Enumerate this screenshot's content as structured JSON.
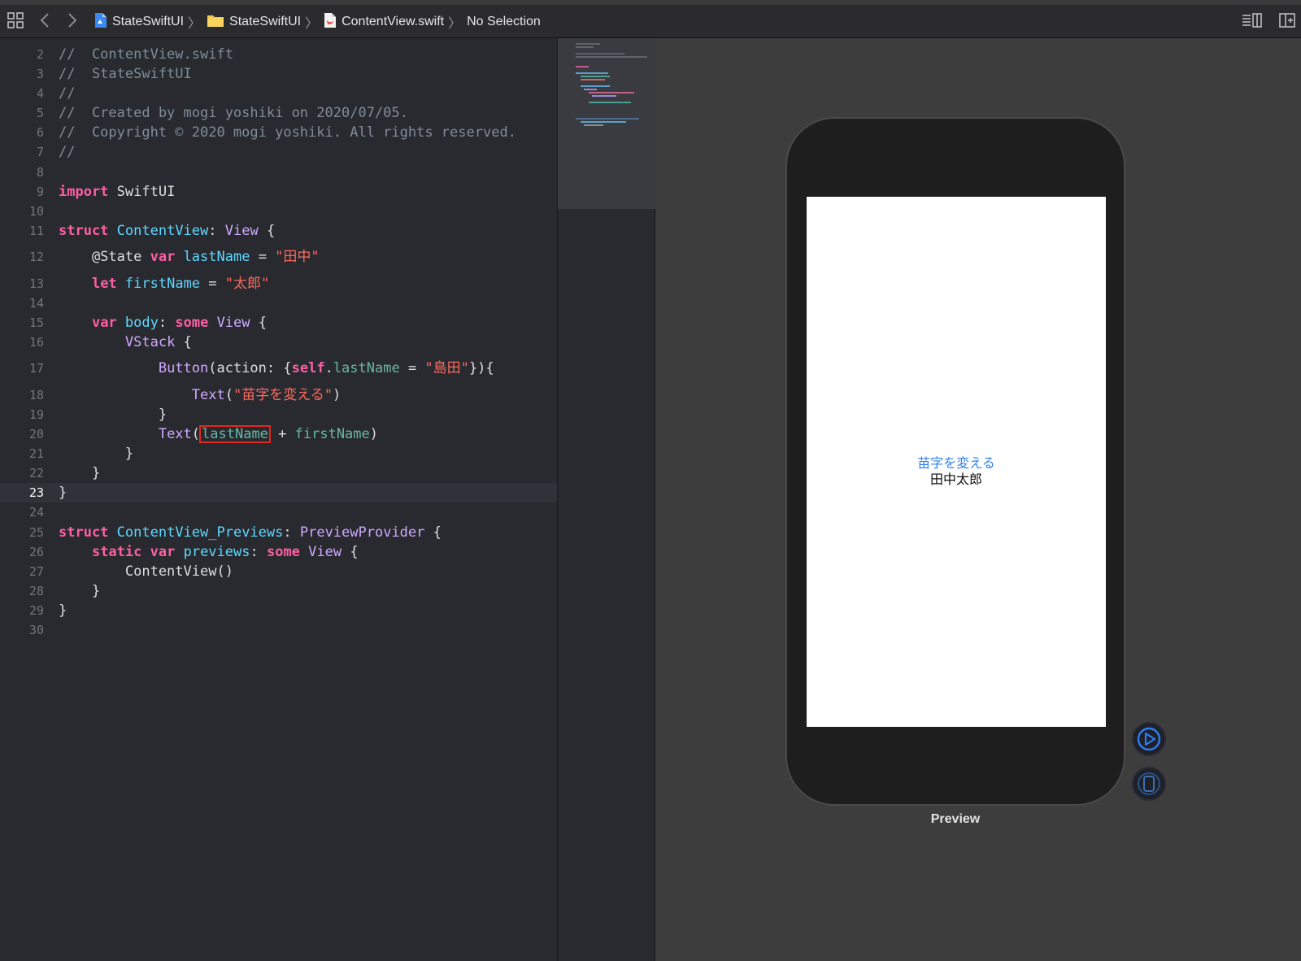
{
  "breadcrumb": {
    "project": "StateSwiftUI",
    "folder": "StateSwiftUI",
    "file": "ContentView.swift",
    "selection": "No Selection"
  },
  "editor": {
    "lines": [
      {
        "n": "2",
        "current": false,
        "tokens": [
          {
            "t": "//  ContentView.swift",
            "c": "com"
          }
        ]
      },
      {
        "n": "3",
        "current": false,
        "tokens": [
          {
            "t": "//  StateSwiftUI",
            "c": "com"
          }
        ]
      },
      {
        "n": "4",
        "current": false,
        "tokens": [
          {
            "t": "//",
            "c": "com"
          }
        ]
      },
      {
        "n": "5",
        "current": false,
        "tokens": [
          {
            "t": "//  Created by mogi yoshiki on 2020/07/05.",
            "c": "com"
          }
        ]
      },
      {
        "n": "6",
        "current": false,
        "tokens": [
          {
            "t": "//  Copyright © 2020 mogi yoshiki. All rights reserved.",
            "c": "com"
          }
        ]
      },
      {
        "n": "7",
        "current": false,
        "tokens": [
          {
            "t": "//",
            "c": "com"
          }
        ]
      },
      {
        "n": "8",
        "current": false,
        "tokens": []
      },
      {
        "n": "9",
        "current": false,
        "tokens": [
          {
            "t": "import",
            "c": "kw"
          },
          {
            "t": " SwiftUI",
            "c": "plain"
          }
        ]
      },
      {
        "n": "10",
        "current": false,
        "tokens": []
      },
      {
        "n": "11",
        "current": false,
        "tokens": [
          {
            "t": "struct",
            "c": "kw"
          },
          {
            "t": " ",
            "c": "plain"
          },
          {
            "t": "ContentView",
            "c": "decl"
          },
          {
            "t": ": ",
            "c": "plain"
          },
          {
            "t": "View",
            "c": "type"
          },
          {
            "t": " {",
            "c": "plain"
          }
        ]
      },
      {
        "n": "12",
        "current": false,
        "tokens": [
          {
            "t": "    @State ",
            "c": "plain"
          },
          {
            "t": "var",
            "c": "kw"
          },
          {
            "t": " ",
            "c": "plain"
          },
          {
            "t": "lastName",
            "c": "decl"
          },
          {
            "t": " = ",
            "c": "plain"
          },
          {
            "t": "\"田中\"",
            "c": "str"
          }
        ]
      },
      {
        "n": "13",
        "current": false,
        "tokens": [
          {
            "t": "    ",
            "c": "plain"
          },
          {
            "t": "let",
            "c": "kw"
          },
          {
            "t": " ",
            "c": "plain"
          },
          {
            "t": "firstName",
            "c": "decl"
          },
          {
            "t": " = ",
            "c": "plain"
          },
          {
            "t": "\"太郎\"",
            "c": "str"
          }
        ]
      },
      {
        "n": "14",
        "current": false,
        "tokens": []
      },
      {
        "n": "15",
        "current": false,
        "tokens": [
          {
            "t": "    ",
            "c": "plain"
          },
          {
            "t": "var",
            "c": "kw"
          },
          {
            "t": " ",
            "c": "plain"
          },
          {
            "t": "body",
            "c": "decl"
          },
          {
            "t": ": ",
            "c": "plain"
          },
          {
            "t": "some",
            "c": "kw"
          },
          {
            "t": " ",
            "c": "plain"
          },
          {
            "t": "View",
            "c": "type"
          },
          {
            "t": " {",
            "c": "plain"
          }
        ]
      },
      {
        "n": "16",
        "current": false,
        "tokens": [
          {
            "t": "        ",
            "c": "plain"
          },
          {
            "t": "VStack",
            "c": "type"
          },
          {
            "t": " {",
            "c": "plain"
          }
        ]
      },
      {
        "n": "17",
        "current": false,
        "tokens": [
          {
            "t": "            ",
            "c": "plain"
          },
          {
            "t": "Button",
            "c": "type"
          },
          {
            "t": "(action: {",
            "c": "plain"
          },
          {
            "t": "self",
            "c": "kw"
          },
          {
            "t": ".",
            "c": "plain"
          },
          {
            "t": "lastName",
            "c": "prop"
          },
          {
            "t": " = ",
            "c": "plain"
          },
          {
            "t": "\"島田\"",
            "c": "str"
          },
          {
            "t": "}){",
            "c": "plain"
          }
        ]
      },
      {
        "n": "18",
        "current": false,
        "tokens": [
          {
            "t": "                ",
            "c": "plain"
          },
          {
            "t": "Text",
            "c": "type"
          },
          {
            "t": "(",
            "c": "plain"
          },
          {
            "t": "\"苗字を変える\"",
            "c": "str"
          },
          {
            "t": ")",
            "c": "plain"
          }
        ]
      },
      {
        "n": "19",
        "current": false,
        "tokens": [
          {
            "t": "            }",
            "c": "plain"
          }
        ]
      },
      {
        "n": "20",
        "current": false,
        "tokens": [
          {
            "t": "            ",
            "c": "plain"
          },
          {
            "t": "Text",
            "c": "type"
          },
          {
            "t": "(",
            "c": "plain"
          },
          {
            "t": "lastName",
            "c": "prop",
            "hl": true
          },
          {
            "t": " + ",
            "c": "plain"
          },
          {
            "t": "firstName",
            "c": "prop"
          },
          {
            "t": ")",
            "c": "plain"
          }
        ]
      },
      {
        "n": "21",
        "current": false,
        "tokens": [
          {
            "t": "        }",
            "c": "plain"
          }
        ]
      },
      {
        "n": "22",
        "current": false,
        "tokens": [
          {
            "t": "    }",
            "c": "plain"
          }
        ]
      },
      {
        "n": "23",
        "current": true,
        "tokens": [
          {
            "t": "}",
            "c": "plain"
          }
        ]
      },
      {
        "n": "24",
        "current": false,
        "tokens": []
      },
      {
        "n": "25",
        "current": false,
        "tokens": [
          {
            "t": "struct",
            "c": "kw"
          },
          {
            "t": " ",
            "c": "plain"
          },
          {
            "t": "ContentView_Previews",
            "c": "decl"
          },
          {
            "t": ": ",
            "c": "plain"
          },
          {
            "t": "PreviewProvider",
            "c": "type"
          },
          {
            "t": " {",
            "c": "plain"
          }
        ]
      },
      {
        "n": "26",
        "current": false,
        "tokens": [
          {
            "t": "    ",
            "c": "plain"
          },
          {
            "t": "static",
            "c": "kw"
          },
          {
            "t": " ",
            "c": "plain"
          },
          {
            "t": "var",
            "c": "kw"
          },
          {
            "t": " ",
            "c": "plain"
          },
          {
            "t": "previews",
            "c": "decl"
          },
          {
            "t": ": ",
            "c": "plain"
          },
          {
            "t": "some",
            "c": "kw"
          },
          {
            "t": " ",
            "c": "plain"
          },
          {
            "t": "View",
            "c": "type"
          },
          {
            "t": " {",
            "c": "plain"
          }
        ]
      },
      {
        "n": "27",
        "current": false,
        "tokens": [
          {
            "t": "        ContentView()",
            "c": "plain"
          }
        ]
      },
      {
        "n": "28",
        "current": false,
        "tokens": [
          {
            "t": "    }",
            "c": "plain"
          }
        ]
      },
      {
        "n": "29",
        "current": false,
        "tokens": [
          {
            "t": "}",
            "c": "plain"
          }
        ]
      },
      {
        "n": "30",
        "current": false,
        "tokens": []
      }
    ]
  },
  "preview": {
    "button_text": "苗字を変える",
    "text": "田中太郎",
    "label": "Preview"
  },
  "colors": {
    "editor_bg": "#292a30",
    "canvas_bg": "#3d3d3d",
    "link_blue": "#2f80ed",
    "highlight_red": "#e0291d"
  }
}
